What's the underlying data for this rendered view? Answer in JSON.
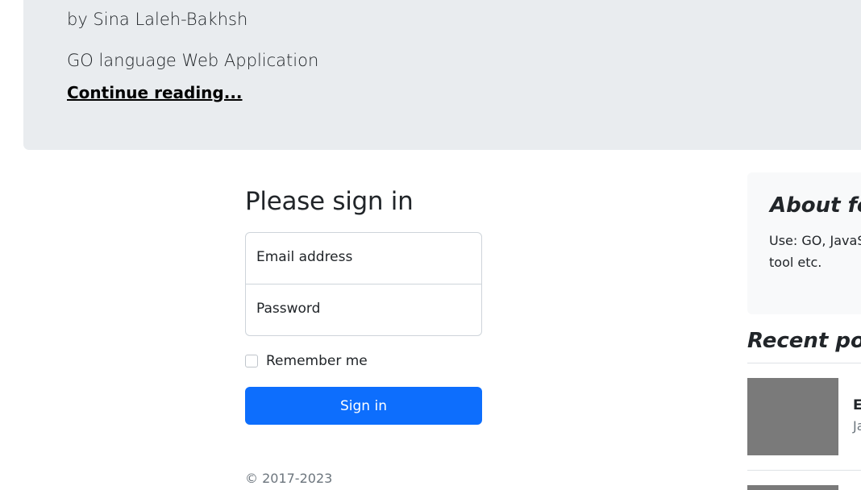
{
  "hero": {
    "author": "by Sina Laleh-Bakhsh",
    "description": "GO language Web Application",
    "link_label": "Continue reading..."
  },
  "signin": {
    "title": "Please sign in",
    "email_label": "Email address",
    "password_label": "Password",
    "remember_label": "Remember me",
    "button_label": "Sign in",
    "remember_checked": false
  },
  "footer": {
    "copyright": "© 2017-2023"
  },
  "sidebar": {
    "about_title": "About fea",
    "about_text": "Use: GO, JavaS of golang tool etc.",
    "recent_title": "Recent post",
    "recent_posts": [
      {
        "title": "E",
        "date": "Ja"
      }
    ]
  },
  "colors": {
    "primary": "#0d6efd",
    "hero_bg": "#e9ecef",
    "sidebar_bg": "#f8f9fa",
    "thumb_placeholder": "#7a7a7a"
  }
}
